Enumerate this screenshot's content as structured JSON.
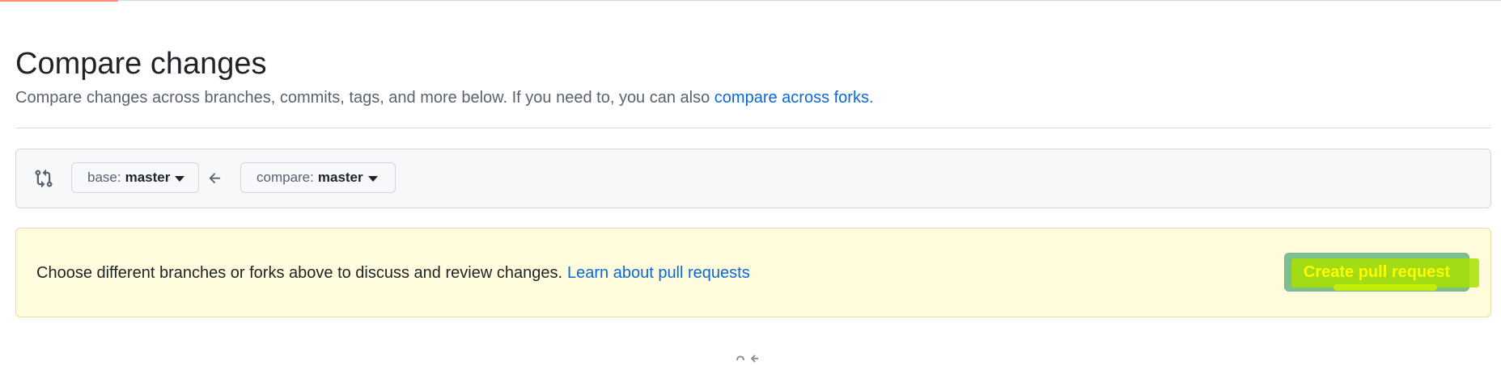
{
  "page": {
    "title": "Compare changes",
    "subtitle_text": "Compare changes across branches, commits, tags, and more below. If you need to, you can also ",
    "subtitle_link": "compare across forks",
    "subtitle_end": "."
  },
  "range": {
    "base_prefix": "base:",
    "base_ref": "master",
    "compare_prefix": "compare:",
    "compare_ref": "master",
    "icons": [
      "git-compare-icon",
      "arrow-left-icon",
      "triangle-down-icon"
    ]
  },
  "flash": {
    "message": "Choose different branches or forks above to discuss and review changes.",
    "link": "Learn about pull requests",
    "button_label": "Create pull request",
    "highlight_color": "#a8e000"
  },
  "colors": {
    "link": "#0969da",
    "flash_bg": "#fffbdd",
    "button_bg": "#7bc08e",
    "button_text": "#fffb00",
    "tab_accent": "#fd8c73"
  }
}
